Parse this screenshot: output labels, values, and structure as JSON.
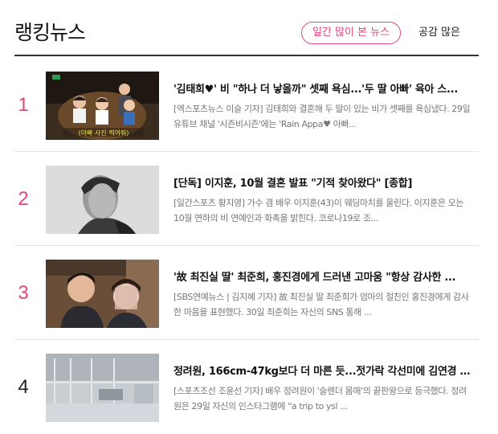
{
  "section_title": "랭킹뉴스",
  "tabs": [
    {
      "label": "일간 많이 본 뉴스",
      "active": true
    },
    {
      "label": "공감 많은",
      "active": false
    }
  ],
  "accent_color": "#e0457b",
  "articles": [
    {
      "rank": "1",
      "headline": "'김태희♥' 비 \"하나 더 낳을까\" 셋째 욕심...'두 딸 아빠' 육아 스...",
      "summary": "[엑스포츠뉴스 이슬 기자] 김태희와 결혼해 두 딸이 있는 비가 셋째를 욕심냈다. 29일 유튜브 채널 '시즌비시즌'에는 'Rain Appa♥ 아빠...",
      "thumb_caption": "(아빠 사진 찍어줘)"
    },
    {
      "rank": "2",
      "headline": "[단독] 이지훈, 10월 결혼 발표 \"기적 찾아왔다\" [종합]",
      "summary": "[일간스포츠 황지영] 가수 겸 배우 이지훈(43)이 웨딩마치를 울린다. 이지훈은 오는 10월 연하의 비 연예인과 화촉을 밝힌다. 코로나19로 조..."
    },
    {
      "rank": "3",
      "headline": "'故 최진실 딸' 최준희, 홍진경에게 드러낸 고마움 \"항상 감사한 ...",
      "summary": "[SBS연예뉴스 | 김지혜 기자] 故 최진실 딸 최준희가 엄마의 절친인 홍진경에게 감사한 마음을 표현했다. 30일 최준희는 자신의 SNS 통해 ..."
    },
    {
      "rank": "4",
      "headline": "정려원, 166cm-47kg보다 더 마른 듯...젓가락 각선미에 김연경 \"...",
      "summary": "[스포츠조선 조윤선 기자] 배우 정려원이 '슬렌더 몸매'의 끝판왕으로 등극했다. 정려원은 29일 자신의 인스타그램에 \"a trip to ysl ..."
    }
  ]
}
